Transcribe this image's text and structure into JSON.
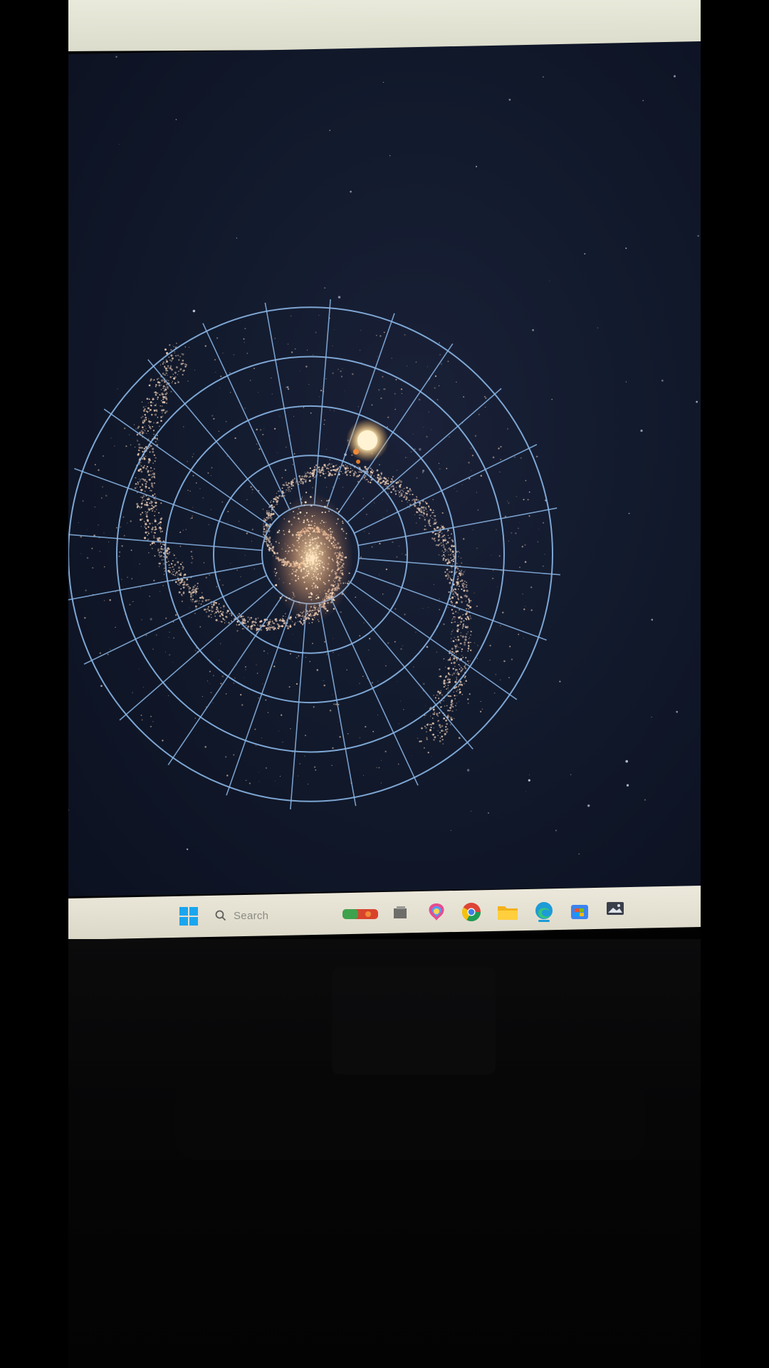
{
  "screen": {
    "background": "#121a2d",
    "app": {
      "name": "galaxy-visualization",
      "galaxy": {
        "arms": 2,
        "grid": "polar",
        "grid_rings": 5,
        "grid_spokes": 24
      },
      "colors": {
        "grid": "#8ab6e6",
        "stars": "#f3d2b8",
        "core": "#ffe2b0",
        "sun": "#ffe8b0"
      }
    }
  },
  "taskbar": {
    "search": {
      "placeholder": "Search"
    },
    "apps": [
      {
        "name": "widgets-icon"
      },
      {
        "name": "task-view-icon"
      },
      {
        "name": "copilot-icon"
      },
      {
        "name": "chrome-icon"
      },
      {
        "name": "file-explorer-icon"
      },
      {
        "name": "edge-icon"
      },
      {
        "name": "store-icon"
      },
      {
        "name": "photos-icon"
      }
    ],
    "colors": {
      "background": "#e6e3d6",
      "start": "#1aa6ee",
      "text": "#8b8b85"
    }
  }
}
